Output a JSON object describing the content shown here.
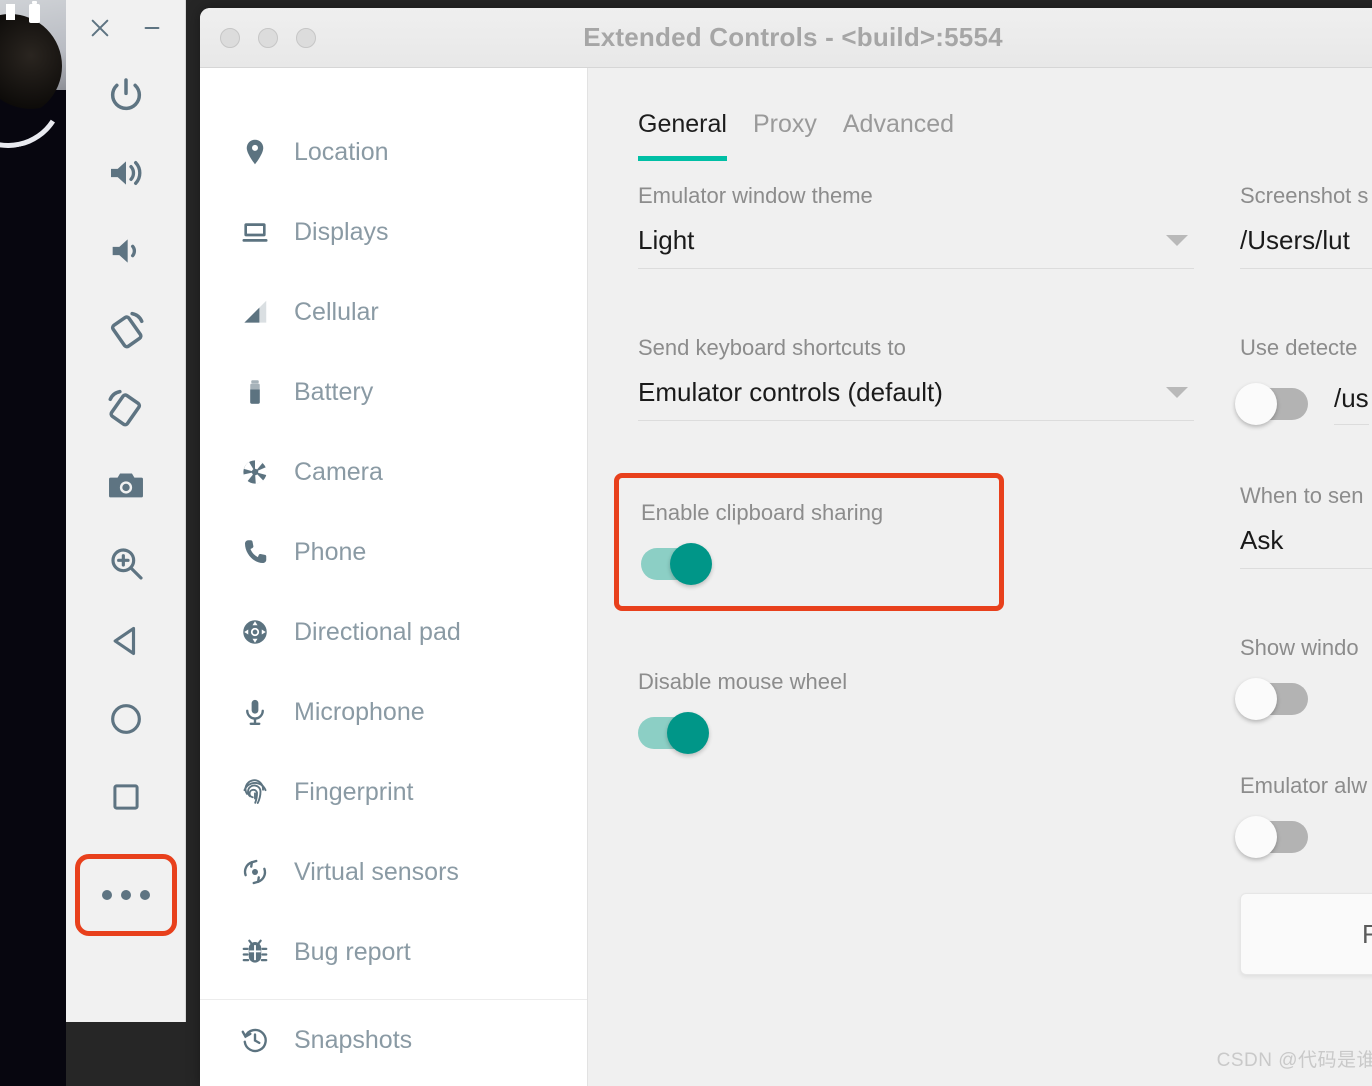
{
  "window": {
    "title": "Extended Controls - <build>:5554",
    "traffic_lights": [
      "close",
      "minimize",
      "zoom"
    ]
  },
  "emulator_toolbar": {
    "close_label": "×",
    "minimize_label": "−",
    "buttons": [
      {
        "name": "power",
        "label": "Power"
      },
      {
        "name": "volume-up",
        "label": "Volume up"
      },
      {
        "name": "volume-down",
        "label": "Volume down"
      },
      {
        "name": "rotate-left",
        "label": "Rotate left"
      },
      {
        "name": "rotate-right",
        "label": "Rotate right"
      },
      {
        "name": "screenshot",
        "label": "Take screenshot"
      },
      {
        "name": "zoom",
        "label": "Enter zoom mode"
      },
      {
        "name": "back",
        "label": "Back"
      },
      {
        "name": "home",
        "label": "Home"
      },
      {
        "name": "overview",
        "label": "Overview"
      },
      {
        "name": "more",
        "label": "More"
      }
    ],
    "highlighted_button": "more"
  },
  "sidebar": {
    "items": [
      {
        "label": "Location",
        "icon": "location-pin-icon"
      },
      {
        "label": "Displays",
        "icon": "display-icon"
      },
      {
        "label": "Cellular",
        "icon": "cellular-signal-icon"
      },
      {
        "label": "Battery",
        "icon": "battery-icon"
      },
      {
        "label": "Camera",
        "icon": "camera-aperture-icon"
      },
      {
        "label": "Phone",
        "icon": "phone-icon"
      },
      {
        "label": "Directional pad",
        "icon": "dpad-icon"
      },
      {
        "label": "Microphone",
        "icon": "microphone-icon"
      },
      {
        "label": "Fingerprint",
        "icon": "fingerprint-icon"
      },
      {
        "label": "Virtual sensors",
        "icon": "virtual-sensors-icon"
      },
      {
        "label": "Bug report",
        "icon": "bug-icon"
      }
    ],
    "items_after_divider": [
      {
        "label": "Snapshots",
        "icon": "snapshot-history-icon"
      }
    ]
  },
  "main": {
    "tabs": [
      {
        "label": "General",
        "active": true
      },
      {
        "label": "Proxy",
        "active": false
      },
      {
        "label": "Advanced",
        "active": false
      }
    ],
    "left_column": {
      "theme": {
        "label": "Emulator window theme",
        "value": "Light"
      },
      "keyboard_shortcuts": {
        "label": "Send keyboard shortcuts to",
        "value": "Emulator controls (default)"
      },
      "clipboard": {
        "label": "Enable clipboard sharing",
        "state": "on",
        "highlighted": true
      },
      "mouse_wheel": {
        "label": "Disable mouse wheel",
        "state": "on"
      }
    },
    "right_column": {
      "screenshot_path": {
        "label": "Screenshot s",
        "value": "/Users/lut"
      },
      "detected_adb": {
        "label": "Use detecte",
        "state": "off",
        "value": "/us"
      },
      "when_to_send": {
        "label": "When to sen",
        "value": "Ask"
      },
      "show_window": {
        "label": "Show windo",
        "state": "off"
      },
      "always_on_top": {
        "label": "Emulator alw",
        "state": "off"
      },
      "action_button": {
        "label": "F"
      }
    }
  },
  "watermark": "CSDN @代码是谁",
  "colors": {
    "accent_teal": "#00bfa5",
    "toggle_on_knob": "#009688",
    "toggle_on_track": "#8ccfc5",
    "highlight_red": "#e8401c",
    "sidebar_text": "#8a9aa4",
    "icon_slate": "#5c7380"
  }
}
